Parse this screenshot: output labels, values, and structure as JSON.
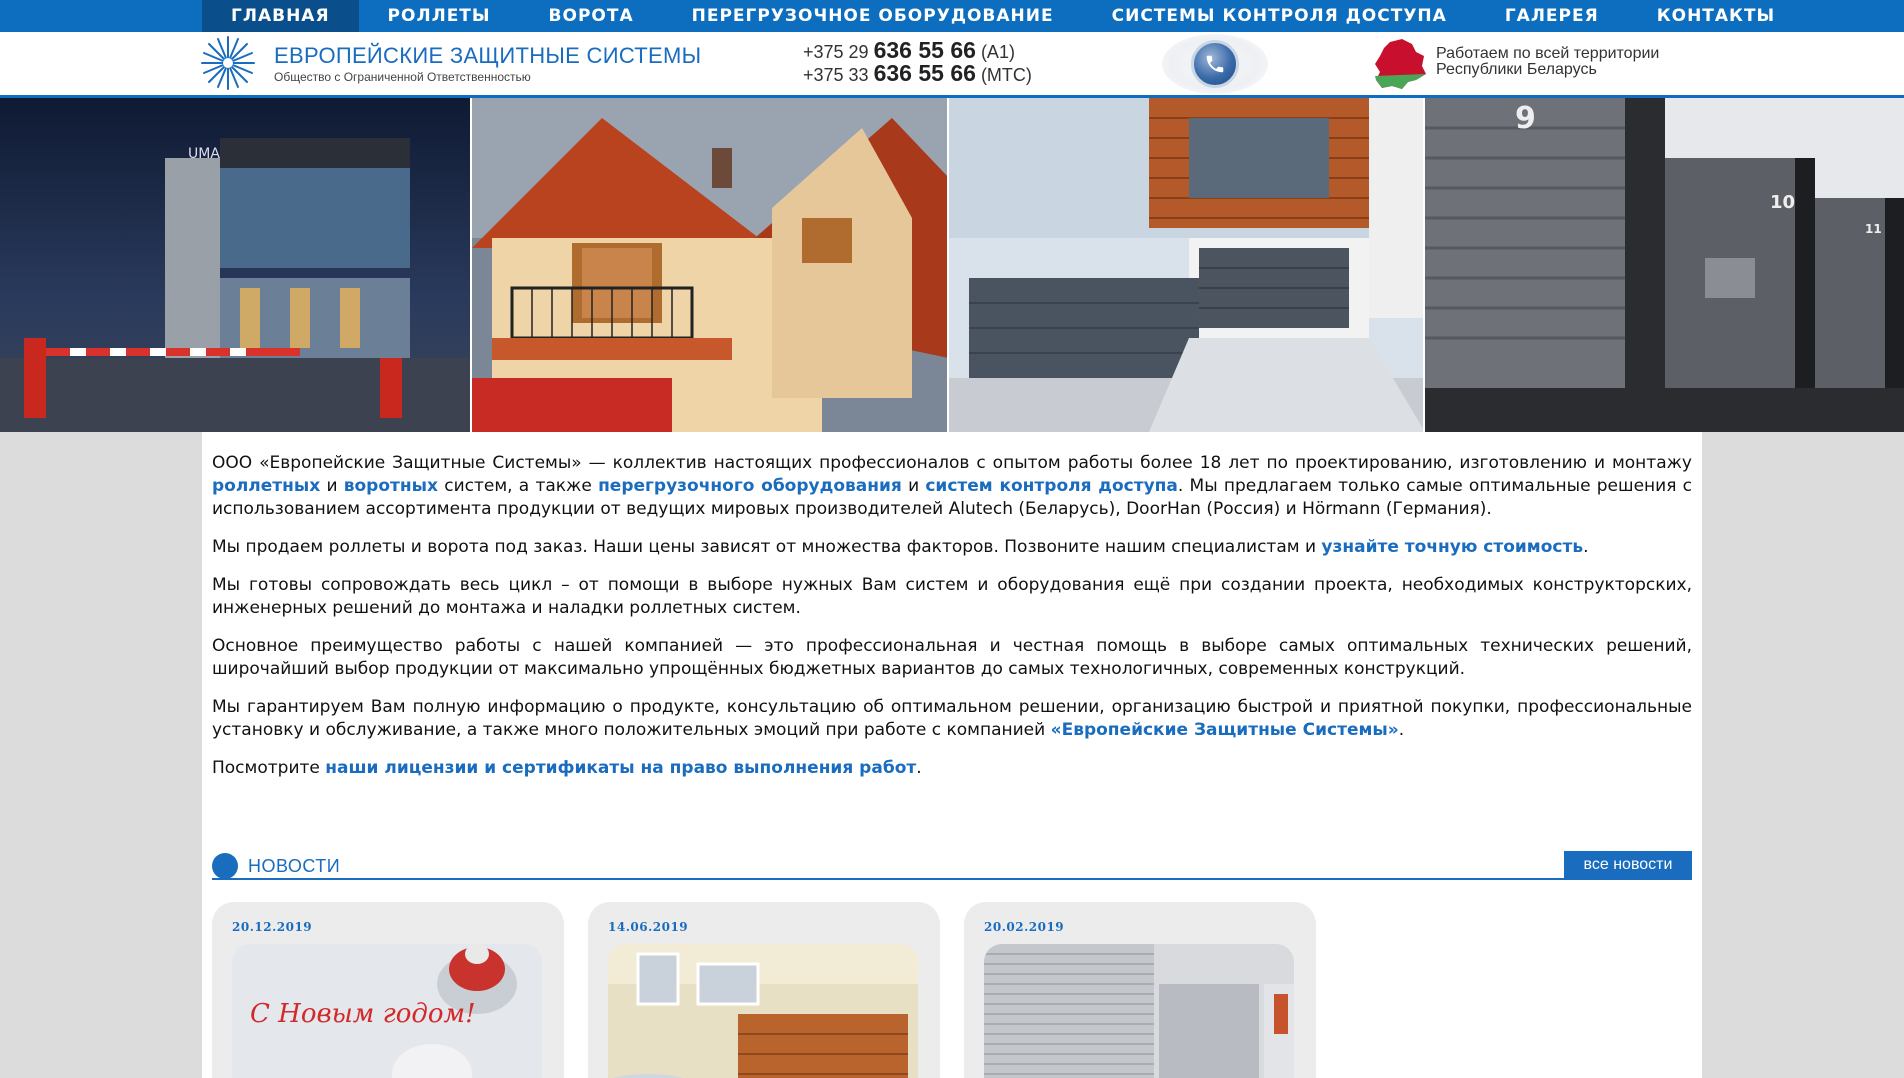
{
  "nav": {
    "items": [
      {
        "label": "ГЛАВНАЯ",
        "active": true
      },
      {
        "label": "РОЛЛЕТЫ",
        "active": false
      },
      {
        "label": "ВОРОТА",
        "active": false
      },
      {
        "label": "ПЕРЕГРУЗОЧНОЕ ОБОРУДОВАНИЕ",
        "active": false
      },
      {
        "label": "СИСТЕМЫ КОНТРОЛЯ ДОСТУПА",
        "active": false
      },
      {
        "label": "ГАЛЕРЕЯ",
        "active": false
      },
      {
        "label": "КОНТАКТЫ",
        "active": false
      }
    ]
  },
  "header": {
    "company_name": "ЕВРОПЕЙСКИЕ ЗАЩИТНЫЕ СИСТЕМЫ",
    "company_sub": "Общество с Ограниченной Ответственностью",
    "phones": [
      {
        "prefix": "+375 29",
        "number": "636 55 66",
        "operator": "(A1)"
      },
      {
        "prefix": "+375 33",
        "number": "636 55 66",
        "operator": "(МТС)"
      }
    ],
    "region_line1": "Работаем по всей территории",
    "region_line2": "Республики Беларусь"
  },
  "intro": {
    "p1": {
      "t1": "ООО «Европейские Защитные Системы» — коллектив настоящих профессионалов с опытом работы более 18 лет по проектированию, изготовлению и монтажу ",
      "l1": "роллетных",
      "t2": " и ",
      "l2": "воротных",
      "t3": " систем, а также ",
      "l3": "перегрузочного оборудования",
      "t4": " и ",
      "l4": "систем контроля доступа",
      "t5": ". Мы предлагаем только самые оптимальные решения с использованием ассортимента продукции от ведущих мировых производителей Alutech (Беларусь), DoorHan (Россия) и Hörmann (Германия)."
    },
    "p2": {
      "t1": "Мы продаем роллеты и ворота под заказ. Наши цены зависят от множества факторов. Позвоните нашим специалистам и ",
      "l1": "узнайте точную стоимость",
      "t2": "."
    },
    "p3": "Мы готовы сопровождать весь цикл – от помощи в выборе нужных Вам систем и оборудования ещё при создании проекта, необходимых конструкторских, инженерных решений до монтажа и наладки роллетных систем.",
    "p4": "Основное преимущество работы с нашей компанией — это профессиональная и честная помощь в выборе самых оптимальных технических решений, широчайший выбор продукции от максимально упрощённых бюджетных вариантов до самых технологичных, современных конструкций.",
    "p5": {
      "t1": "Мы гарантируем Вам полную информацию о продукте, консультацию об оптимальном решении, организацию быстрой и приятной покупки, профессиональные установку и обслуживание, а также много положительных эмоций при работе с компанией ",
      "l1": "«Европейские Защитные Системы»",
      "t2": "."
    },
    "p6": {
      "t1": "Посмотрите ",
      "l1": "наши лицензии и сертификаты на право выполнения работ",
      "t2": "."
    }
  },
  "news": {
    "title": "НОВОСТИ",
    "all_label": "все новости",
    "items": [
      {
        "date": "20.12.2019",
        "image_text": "С Новым годом!"
      },
      {
        "date": "14.06.2019"
      },
      {
        "date": "20.02.2019"
      }
    ]
  },
  "colors": {
    "brand": "#0d6ebf",
    "link": "#1a6cbf",
    "nav_active": "#0a4f8c"
  }
}
